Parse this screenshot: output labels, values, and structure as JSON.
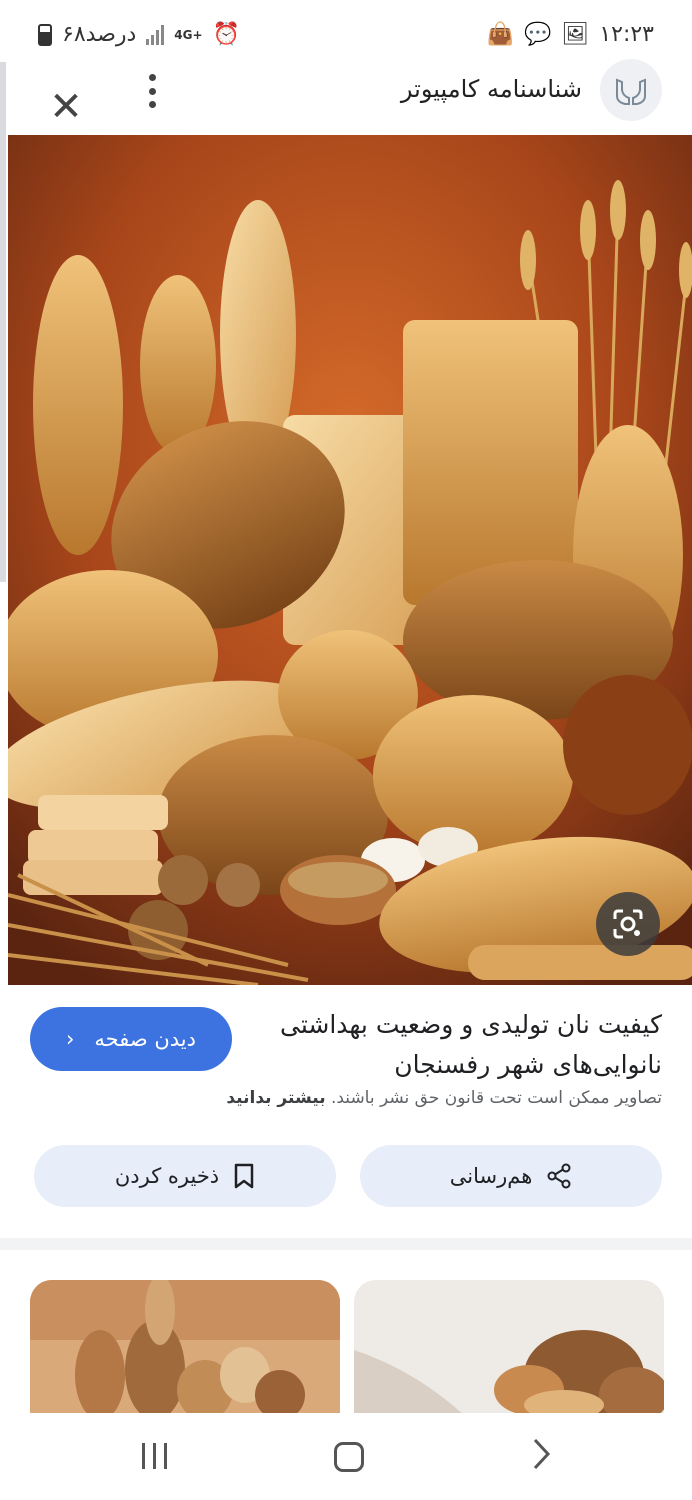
{
  "status_bar": {
    "time": "۱۲:۲۳",
    "battery": "۶۸درصد",
    "network": "4G+"
  },
  "header": {
    "site_name": "شناسنامه کامپیوتر",
    "close_icon": "close-icon",
    "more_icon": "more-vert-icon"
  },
  "image": {
    "description_icon": "lens-icon"
  },
  "info": {
    "title": "کیفیت نان تولیدی و وضعیت بهداشتی نانوایی‌های شهر رفسنجان",
    "visit_label": "دیدن صفحه",
    "copyright_text": "تصاویر ممکن است تحت قانون حق نشر باشند.",
    "learn_more": "بیشتر بدانید"
  },
  "actions": {
    "share_label": "هم‌رسانی",
    "save_label": "ذخیره کردن"
  },
  "colors": {
    "accent": "#3c73e0",
    "button_bg": "#e8eef9"
  }
}
